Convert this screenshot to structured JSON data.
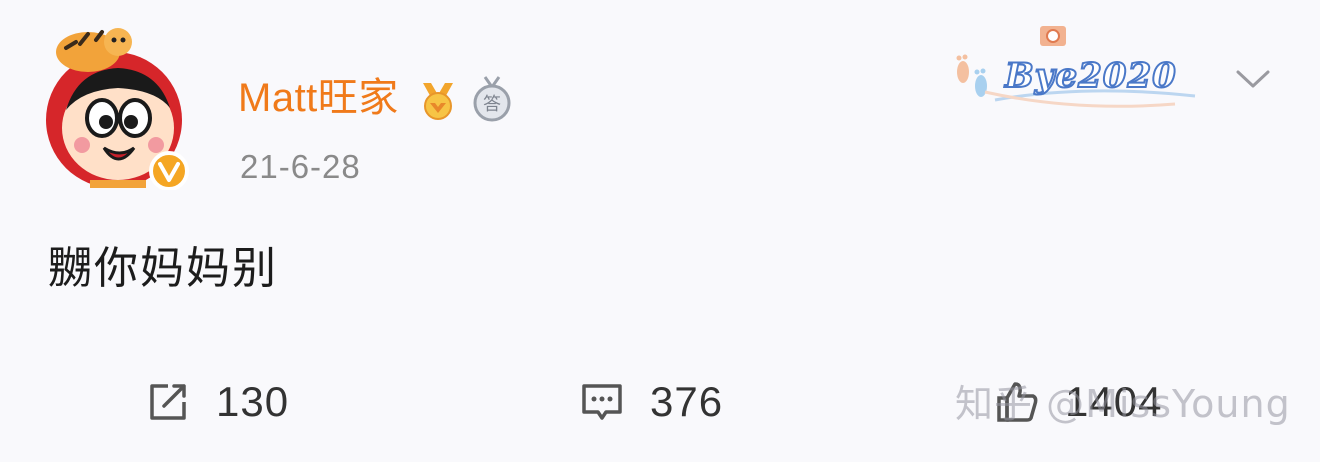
{
  "post": {
    "username": "Matt旺家",
    "timestamp": "21-6-28",
    "text": "嬲你妈妈别",
    "decoration_text": "Bye2020",
    "badge_char": "答"
  },
  "actions": {
    "repost_count": "130",
    "comment_count": "376",
    "like_count": "1404"
  },
  "watermark": "知乎 @MissYoung",
  "colors": {
    "username": "#f07a1a",
    "timestamp": "#8a8a8a",
    "verified_badge": "#f5a623",
    "background": "#f9f9fc"
  },
  "icons": {
    "repost": "repost-icon",
    "comment": "comment-icon",
    "like": "like-icon",
    "chevron": "chevron-down-icon",
    "verified": "verified-v-icon"
  }
}
